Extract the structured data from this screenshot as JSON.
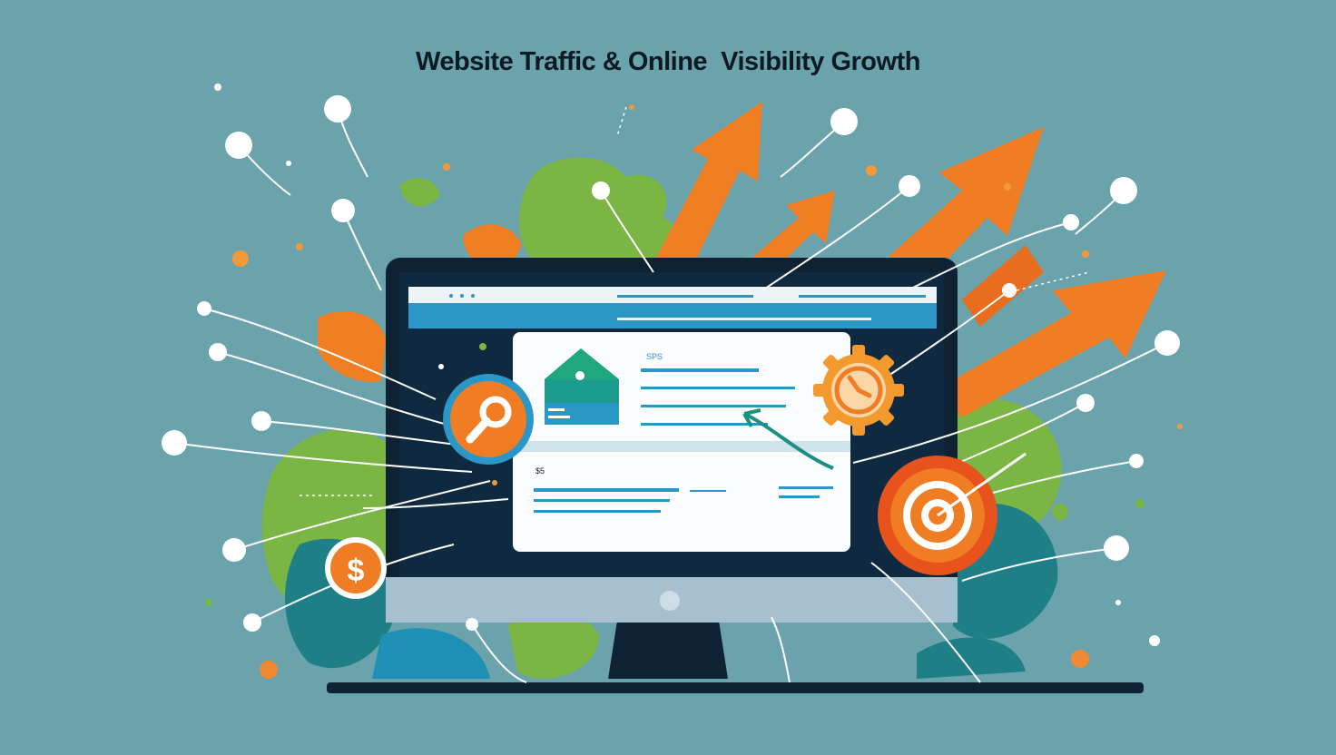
{
  "title": "Website Traffic & Online  Visibility Growth",
  "icons": {
    "dollar": {
      "name": "dollar-icon",
      "glyph": "$"
    },
    "magnifier": {
      "name": "magnifier-icon"
    },
    "gear": {
      "name": "gear-icon"
    },
    "target": {
      "name": "target-icon"
    },
    "house": {
      "name": "house-icon"
    },
    "arrows": {
      "name": "growth-arrow-icon"
    }
  },
  "colors": {
    "background": "#6ba3ac",
    "orange": "#ef7f22",
    "green": "#7bb543",
    "teal": "#1f8a8a",
    "navy": "#0e2233",
    "browser_bar": "#2b97c7",
    "white": "#ffffff"
  },
  "mockup": {
    "micro_label_1": "SPS",
    "micro_label_2": "$5"
  }
}
